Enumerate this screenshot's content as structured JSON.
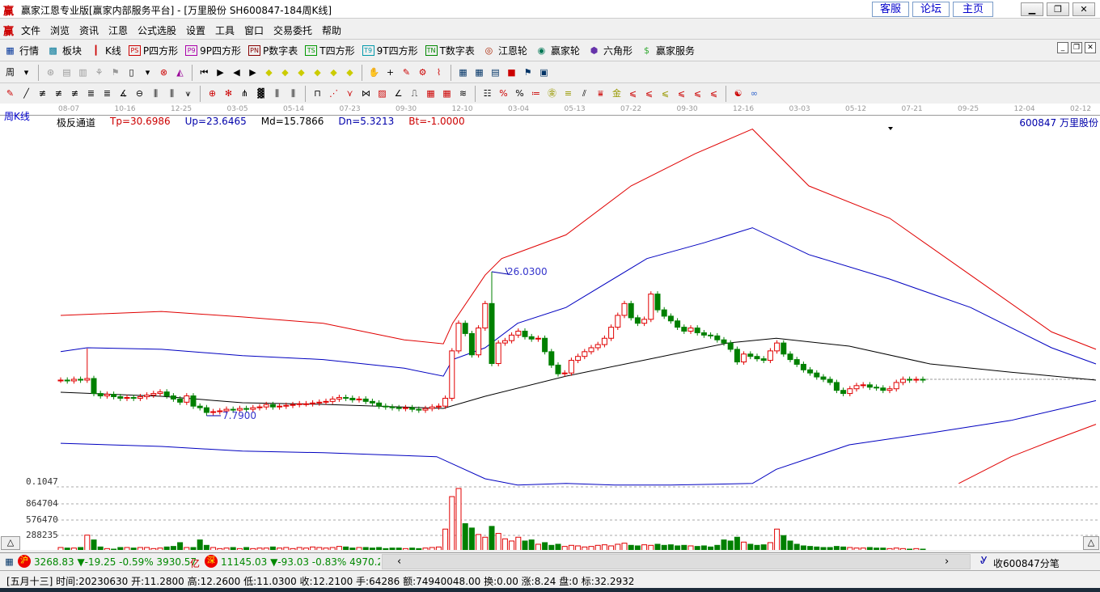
{
  "window": {
    "logo": "赢",
    "title": "赢家江恩专业版[赢家内部服务平台] - [万里股份  SH600847-184周K线]",
    "links": [
      "客服",
      "论坛",
      "主页"
    ],
    "controls": [
      "minimize",
      "restore",
      "close"
    ]
  },
  "menu": {
    "logo": "赢",
    "items": [
      "文件",
      "浏览",
      "资讯",
      "江恩",
      "公式选股",
      "设置",
      "工具",
      "窗口",
      "交易委托",
      "帮助"
    ]
  },
  "toolbar1": [
    {
      "icon": "table-icon",
      "glyph": "▦",
      "color": "#003399",
      "label": "行情"
    },
    {
      "icon": "blocks-icon",
      "glyph": "▩",
      "color": "#007799",
      "label": "板块"
    },
    {
      "icon": "candles-icon",
      "glyph": "┃",
      "color": "#cc0000",
      "label": "K线"
    },
    {
      "icon": "ps-icon",
      "glyph": "PS",
      "color": "#cc0000",
      "box": true,
      "label": "P四方形"
    },
    {
      "icon": "p9-icon",
      "glyph": "P9",
      "color": "#aa00aa",
      "box": true,
      "label": "9P四方形"
    },
    {
      "icon": "pn-icon",
      "glyph": "PN",
      "color": "#880000",
      "box": true,
      "label": "P数字表"
    },
    {
      "icon": "ts-icon",
      "glyph": "TS",
      "color": "#009900",
      "box": true,
      "label": "T四方形"
    },
    {
      "icon": "t9-icon",
      "glyph": "T9",
      "color": "#0099aa",
      "box": true,
      "label": "9T四方形"
    },
    {
      "icon": "tn-icon",
      "glyph": "TN",
      "color": "#008800",
      "box": true,
      "label": "T数字表"
    },
    {
      "icon": "gann-wheel-icon",
      "glyph": "◎",
      "color": "#aa2200",
      "label": "江恩轮"
    },
    {
      "icon": "winner-wheel-icon",
      "glyph": "◉",
      "color": "#007755",
      "label": "赢家轮"
    },
    {
      "icon": "hexagon-icon",
      "glyph": "⬢",
      "color": "#6633aa",
      "label": "六角形"
    },
    {
      "icon": "dollar-icon",
      "glyph": "$",
      "color": "#33aa33",
      "label": "赢家服务"
    }
  ],
  "toolbar2": [
    [
      "period-icon",
      "周",
      "#000"
    ],
    [
      "dropdown-icon",
      "▾",
      "#000"
    ],
    [
      "sep"
    ],
    [
      "tool-icon",
      "⊛",
      "#999"
    ],
    [
      "tool-icon",
      "▤",
      "#999"
    ],
    [
      "tool-icon",
      "▥",
      "#999"
    ],
    [
      "tool-icon",
      "⚘",
      "#999"
    ],
    [
      "tool-icon",
      "⚑",
      "#999"
    ],
    [
      "tool-icon",
      "▯",
      "#000"
    ],
    [
      "dropdown-icon",
      "▾",
      "#000"
    ],
    [
      "crosshair-icon",
      "⊗",
      "#c00"
    ],
    [
      "draw-icon",
      "◭",
      "#909"
    ],
    [
      "sep"
    ],
    [
      "first-icon",
      "⏮",
      "#000"
    ],
    [
      "next-icon",
      "▶",
      "#000"
    ],
    [
      "prev-icon",
      "◀",
      "#000"
    ],
    [
      "forward-icon",
      "▶",
      "#000"
    ],
    [
      "zoom-icon",
      "◆",
      "#cc0"
    ],
    [
      "zoom-icon",
      "◆",
      "#cc0"
    ],
    [
      "zoom-icon",
      "◆",
      "#cc0"
    ],
    [
      "zoom-icon",
      "◆",
      "#cc0"
    ],
    [
      "zoom-icon",
      "◆",
      "#cc0"
    ],
    [
      "zoom-icon",
      "◆",
      "#cc0"
    ],
    [
      "sep"
    ],
    [
      "hand-icon",
      "✋",
      "#000"
    ],
    [
      "cross-icon",
      "+",
      "#000"
    ],
    [
      "pencil-icon",
      "✎",
      "#c00"
    ],
    [
      "draw-icon",
      "⚙",
      "#c00"
    ],
    [
      "draw-icon",
      "⌇",
      "#c00"
    ],
    [
      "sep"
    ],
    [
      "calendar-icon",
      "▦",
      "#036"
    ],
    [
      "calc-icon",
      "▦",
      "#036"
    ],
    [
      "note-icon",
      "▤",
      "#036"
    ],
    [
      "save-icon",
      "■",
      "#c00"
    ],
    [
      "network-icon",
      "⚑",
      "#036"
    ],
    [
      "print-icon",
      "▣",
      "#036"
    ]
  ],
  "toolbar3": [
    [
      "pen-icon",
      "✎",
      "#c00"
    ],
    [
      "line-icon",
      "╱",
      "#000"
    ],
    [
      "tool-icon",
      "≢",
      "#000"
    ],
    [
      "tool-icon",
      "≢",
      "#000"
    ],
    [
      "tool-icon",
      "≢",
      "#000"
    ],
    [
      "tool-icon",
      "≣",
      "#000"
    ],
    [
      "tool-icon",
      "≣",
      "#000"
    ],
    [
      "tool-icon",
      "∡",
      "#000"
    ],
    [
      "circle-icon",
      "⊖",
      "#000"
    ],
    [
      "tool-icon",
      "⫼",
      "#000"
    ],
    [
      "tool-icon",
      "⫼",
      "#000"
    ],
    [
      "tool-icon",
      "⩛",
      "#000"
    ],
    [
      "sep"
    ],
    [
      "tool-icon",
      "⊕",
      "#c00"
    ],
    [
      "tool-icon",
      "✻",
      "#c00"
    ],
    [
      "tool-icon",
      "⋔",
      "#000"
    ],
    [
      "tool-icon",
      "▓",
      "#000"
    ],
    [
      "tool-icon",
      "⫼",
      "#000"
    ],
    [
      "tool-icon",
      "⫼",
      "#000"
    ],
    [
      "sep"
    ],
    [
      "tool-icon",
      "⊓",
      "#000"
    ],
    [
      "fan-icon",
      "⋰",
      "#c00"
    ],
    [
      "tool-icon",
      "⋎",
      "#c00"
    ],
    [
      "tool-icon",
      "⋈",
      "#000"
    ],
    [
      "tool-icon",
      "▨",
      "#c00"
    ],
    [
      "tool-icon",
      "∠",
      "#000"
    ],
    [
      "tool-icon",
      "⎍",
      "#000"
    ],
    [
      "grid-icon",
      "▦",
      "#c00"
    ],
    [
      "grid-icon",
      "▦",
      "#c00"
    ],
    [
      "lines-icon",
      "≋",
      "#000"
    ],
    [
      "sep"
    ],
    [
      "tool-icon",
      "☷",
      "#000"
    ],
    [
      "tool-icon",
      "%",
      "#c00"
    ],
    [
      "percent-icon",
      "%",
      "#000"
    ],
    [
      "tool-icon",
      "≔",
      "#c00"
    ],
    [
      "gold-icon",
      "㊎",
      "#990"
    ],
    [
      "gold-icon",
      "≡",
      "#990"
    ],
    [
      "tool-icon",
      "⫽",
      "#000"
    ],
    [
      "tool-icon",
      "⩸",
      "#c00"
    ],
    [
      "gold-icon",
      "金",
      "#990"
    ],
    [
      "tool-icon",
      "⩽",
      "#c00"
    ],
    [
      "tool-icon",
      "⩽",
      "#c00"
    ],
    [
      "tool-icon",
      "⩽",
      "#990"
    ],
    [
      "tool-icon",
      "⩽",
      "#c00"
    ],
    [
      "tool-icon",
      "⩽",
      "#c00"
    ],
    [
      "tool-icon",
      "⩽",
      "#c00"
    ],
    [
      "sep"
    ],
    [
      "taiji-icon",
      "☯",
      "#c00"
    ],
    [
      "infinity-icon",
      "∞",
      "#36c"
    ]
  ],
  "chart": {
    "period_label": "周K线",
    "date_ticks": [
      "08-07",
      "10-16",
      "12-25",
      "03-05",
      "05-14",
      "07-23",
      "09-30",
      "12-10",
      "03-04",
      "05-13",
      "07-22",
      "09-30",
      "12-16",
      "03-03",
      "05-12",
      "07-21",
      "09-25",
      "12-04",
      "02-12"
    ],
    "indicator": {
      "name": "极反通道",
      "tp": "Tp=30.6986",
      "up": "Up=23.6465",
      "md": "Md=15.7866",
      "dn": "Dn=5.3213",
      "bt": "Bt=-1.0000"
    },
    "stock_label": "600847 万里股份",
    "high_label": "26.0300",
    "low_label": "7.7900",
    "volume_ticks": [
      "0.1047",
      "864704",
      "576470",
      "288235"
    ]
  },
  "chart_data": {
    "type": "candlestick",
    "title": "万里股份 SH600847 周K线",
    "close": [
      12.3,
      12.2,
      12.4,
      12.3,
      12.5,
      10.6,
      10.3,
      10.5,
      10.2,
      10.0,
      10.1,
      10.0,
      10.2,
      10.4,
      10.6,
      10.8,
      10.3,
      9.9,
      9.5,
      10.3,
      9.0,
      8.8,
      8.2,
      8.3,
      8.4,
      8.6,
      8.5,
      8.7,
      8.6,
      8.8,
      8.9,
      9.2,
      8.9,
      9.0,
      9.1,
      9.2,
      9.3,
      9.3,
      9.4,
      9.5,
      9.6,
      9.9,
      10.1,
      10.0,
      9.8,
      9.9,
      9.6,
      9.4,
      9.0,
      8.9,
      8.8,
      8.7,
      8.8,
      8.6,
      8.5,
      8.7,
      8.9,
      9.0,
      10.0,
      16.0,
      19.5,
      18.2,
      15.5,
      18.9,
      22.0,
      14.4,
      17.0,
      17.3,
      18.0,
      18.5,
      17.8,
      17.5,
      17.6,
      15.9,
      14.2,
      13.1,
      13.2,
      14.8,
      15.3,
      15.9,
      16.4,
      16.8,
      17.6,
      19.0,
      20.5,
      22.0,
      20.2,
      19.5,
      20.0,
      23.2,
      21.2,
      20.4,
      19.8,
      19.0,
      18.5,
      18.9,
      18.3,
      18.0,
      17.9,
      17.4,
      17.0,
      16.2,
      14.6,
      15.6,
      15.3,
      15.0,
      14.8,
      16.0,
      17.0,
      15.6,
      14.9,
      14.3,
      13.6,
      13.2,
      12.7,
      12.4,
      12.0,
      11.0,
      10.6,
      11.2,
      11.6,
      11.7,
      11.4,
      11.3,
      11.0,
      11.2,
      12.0,
      12.4,
      12.3,
      12.4,
      12.3
    ],
    "volume": [
      60000,
      50000,
      50000,
      60000,
      288235,
      200000,
      70000,
      40000,
      30000,
      60000,
      60000,
      50000,
      60000,
      60000,
      40000,
      50000,
      70000,
      80000,
      150000,
      60000,
      60000,
      200000,
      100000,
      60000,
      40000,
      50000,
      60000,
      40000,
      60000,
      40000,
      50000,
      50000,
      70000,
      50000,
      60000,
      40000,
      60000,
      50000,
      70000,
      60000,
      50000,
      60000,
      80000,
      70000,
      50000,
      60000,
      60000,
      50000,
      60000,
      40000,
      50000,
      50000,
      40000,
      50000,
      40000,
      50000,
      60000,
      70000,
      400000,
      1000000,
      1150000,
      500000,
      420000,
      300000,
      250000,
      450000,
      320000,
      220000,
      180000,
      250000,
      180000,
      200000,
      120000,
      150000,
      100000,
      120000,
      80000,
      100000,
      90000,
      70000,
      80000,
      100000,
      110000,
      90000,
      120000,
      140000,
      100000,
      90000,
      110000,
      100000,
      120000,
      100000,
      110000,
      90000,
      100000,
      90000,
      80000,
      90000,
      70000,
      100000,
      200000,
      180000,
      250000,
      160000,
      120000,
      100000,
      110000,
      150000,
      400000,
      280000,
      180000,
      120000,
      90000,
      80000,
      70000,
      60000,
      60000,
      80000,
      70000,
      60000,
      50000,
      50000,
      60000,
      50000,
      50000,
      40000,
      50000,
      40000,
      30000,
      40000,
      30000
    ],
    "channel": {
      "tp": [
        [
          0,
          20.5
        ],
        [
          15.2,
          21.0
        ],
        [
          27.4,
          20.3
        ],
        [
          39.6,
          19.5
        ],
        [
          51.8,
          17.4
        ],
        [
          57.7,
          16.9
        ],
        [
          59.1,
          19.5
        ],
        [
          64,
          25.6
        ],
        [
          66.5,
          27.7
        ],
        [
          76.2,
          30.7
        ],
        [
          86,
          36.9
        ],
        [
          95.7,
          41.0
        ],
        [
          104.3,
          44.1
        ],
        [
          112.8,
          36.9
        ],
        [
          125,
          32.8
        ],
        [
          137.2,
          25.6
        ],
        [
          149.4,
          18.4
        ],
        [
          156.1,
          16.2
        ]
      ],
      "up": [
        [
          0,
          15.9
        ],
        [
          4,
          16.4
        ],
        [
          15.2,
          16.2
        ],
        [
          27.4,
          15.4
        ],
        [
          39.6,
          14.9
        ],
        [
          51.8,
          13.8
        ],
        [
          57.7,
          12.8
        ],
        [
          59.1,
          14.9
        ],
        [
          64,
          16.4
        ],
        [
          68.9,
          19.5
        ],
        [
          76.2,
          21.5
        ],
        [
          88.4,
          27.7
        ],
        [
          97,
          29.7
        ],
        [
          104.3,
          31.6
        ],
        [
          112.8,
          28.2
        ],
        [
          125,
          25.1
        ],
        [
          137.2,
          21.5
        ],
        [
          149.4,
          16.4
        ],
        [
          156.1,
          14.35
        ]
      ],
      "md": [
        [
          0,
          10.76
        ],
        [
          15.2,
          10.25
        ],
        [
          27.4,
          9.43
        ],
        [
          39.6,
          9.22
        ],
        [
          57.7,
          8.71
        ],
        [
          64,
          10.25
        ],
        [
          76.2,
          12.8
        ],
        [
          88.4,
          14.9
        ],
        [
          100.6,
          17.0
        ],
        [
          107.9,
          17.6
        ],
        [
          118.9,
          16.6
        ],
        [
          131.1,
          14.35
        ],
        [
          143.3,
          13.3
        ],
        [
          156.1,
          12.3
        ]
      ],
      "dn": [
        [
          0,
          4.3
        ],
        [
          15.2,
          3.9
        ],
        [
          27.4,
          3.3
        ],
        [
          39.6,
          3.1
        ],
        [
          56.7,
          2.6
        ],
        [
          64,
          -0.2
        ],
        [
          68.9,
          -1.0
        ],
        [
          76.2,
          -0.8
        ],
        [
          83.5,
          -1.0
        ],
        [
          92,
          -1.0
        ],
        [
          104.3,
          -0.8
        ],
        [
          107.9,
          1.0
        ],
        [
          118.9,
          4.1
        ],
        [
          131.1,
          5.6
        ],
        [
          143.3,
          7.2
        ],
        [
          156.1,
          9.7
        ]
      ],
      "bt": [
        [
          135.4,
          -0.8
        ],
        [
          143.3,
          2.6
        ],
        [
          149.4,
          4.6
        ],
        [
          156.1,
          6.7
        ]
      ]
    },
    "high": 26.03,
    "low": 7.79,
    "last_close": 12.21
  },
  "ticker": {
    "sh_badge": "沪",
    "sh": "3268.83 ▼-19.25 -0.59% 3930.57",
    "sh_unit": "亿",
    "sz_badge": "深",
    "sz": "11145.03 ▼-93.03 -0.83% 4970.20",
    "right": "收600847分笔"
  },
  "status": {
    "text": "[五月十三] 时间:20230630 开:11.2800 高:12.2600 低:11.0300 收:12.2100 手:64286 额:74940048.00 换:0.00 涨:8.24 盘:0 标:32.2932"
  },
  "colors": {
    "up": "#e00000",
    "down": "#008000",
    "mid": "#000000",
    "band_inner": "#0000c0",
    "band_outer": "#e00000"
  }
}
